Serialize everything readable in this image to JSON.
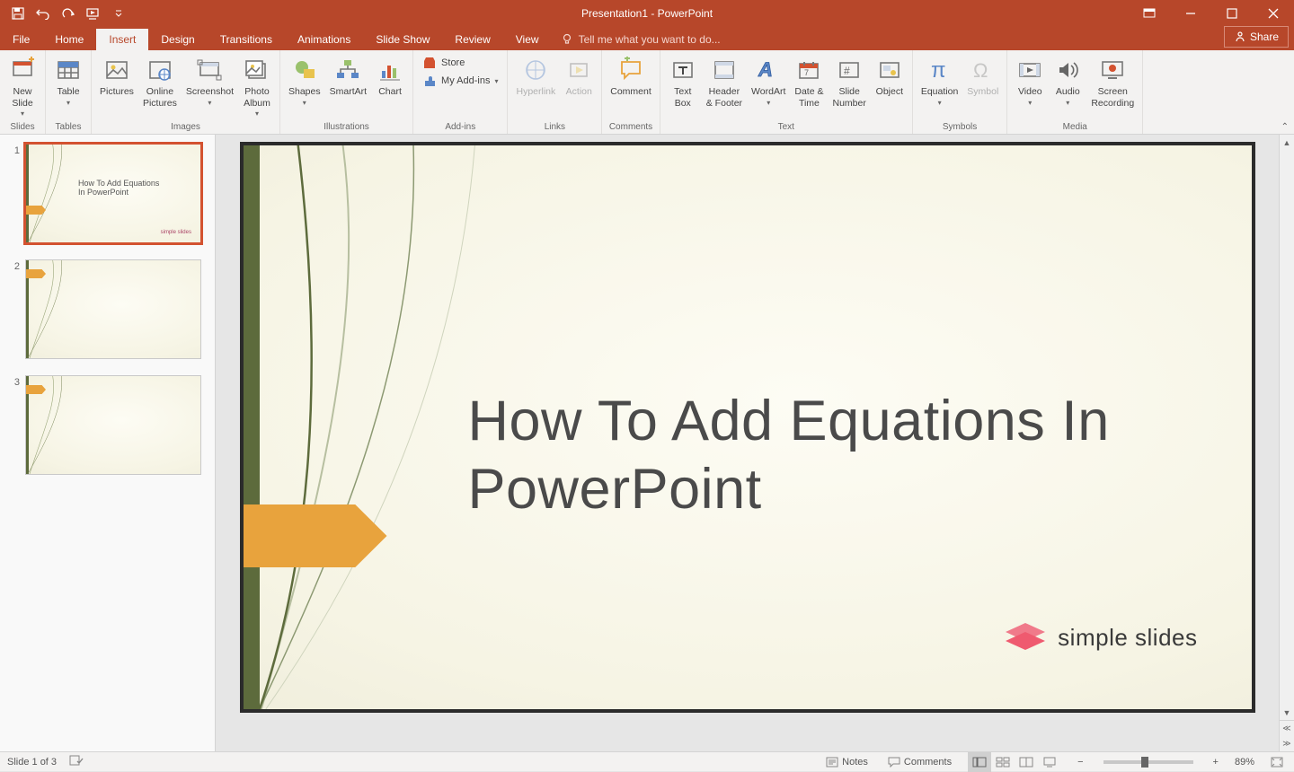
{
  "window": {
    "title": "Presentation1 - PowerPoint",
    "share": "Share"
  },
  "qat": [
    "save",
    "undo",
    "redo",
    "present",
    "customize"
  ],
  "tabs": {
    "file": "File",
    "items": [
      "Home",
      "Insert",
      "Design",
      "Transitions",
      "Animations",
      "Slide Show",
      "Review",
      "View"
    ],
    "active": "Insert",
    "tell_me": "Tell me what you want to do..."
  },
  "ribbon": {
    "groups": [
      {
        "name": "Slides",
        "items": [
          {
            "label": "New\nSlide",
            "dd": true
          }
        ]
      },
      {
        "name": "Tables",
        "items": [
          {
            "label": "Table",
            "dd": true
          }
        ]
      },
      {
        "name": "Images",
        "items": [
          {
            "label": "Pictures"
          },
          {
            "label": "Online\nPictures"
          },
          {
            "label": "Screenshot",
            "dd": true
          },
          {
            "label": "Photo\nAlbum",
            "dd": true
          }
        ]
      },
      {
        "name": "Illustrations",
        "items": [
          {
            "label": "Shapes",
            "dd": true
          },
          {
            "label": "SmartArt"
          },
          {
            "label": "Chart"
          }
        ]
      },
      {
        "name": "Add-ins",
        "addins": {
          "store": "Store",
          "myaddins": "My Add-ins"
        }
      },
      {
        "name": "Links",
        "items": [
          {
            "label": "Hyperlink",
            "disabled": true
          },
          {
            "label": "Action",
            "disabled": true
          }
        ]
      },
      {
        "name": "Comments",
        "items": [
          {
            "label": "Comment"
          }
        ]
      },
      {
        "name": "Text",
        "items": [
          {
            "label": "Text\nBox"
          },
          {
            "label": "Header\n& Footer"
          },
          {
            "label": "WordArt",
            "dd": true
          },
          {
            "label": "Date &\nTime"
          },
          {
            "label": "Slide\nNumber"
          },
          {
            "label": "Object"
          }
        ]
      },
      {
        "name": "Symbols",
        "items": [
          {
            "label": "Equation",
            "dd": true
          },
          {
            "label": "Symbol",
            "disabled": true
          }
        ]
      },
      {
        "name": "Media",
        "items": [
          {
            "label": "Video",
            "dd": true
          },
          {
            "label": "Audio",
            "dd": true
          },
          {
            "label": "Screen\nRecording"
          }
        ]
      }
    ]
  },
  "thumbnails": {
    "count": 3,
    "selected": 1,
    "slide1_title": "How To Add Equations\nIn PowerPoint",
    "logo_mini": "simple slides"
  },
  "slide": {
    "title": "How To Add Equations In PowerPoint",
    "logo": "simple slides"
  },
  "status": {
    "slide_pos": "Slide 1 of 3",
    "notes": "Notes",
    "comments": "Comments",
    "zoom_pct": "89%"
  },
  "colors": {
    "accent": "#b7472a",
    "slide_arrow": "#e8a33d",
    "slide_bar": "#5d6b3c",
    "logo_pink": "#ef5a6f"
  }
}
